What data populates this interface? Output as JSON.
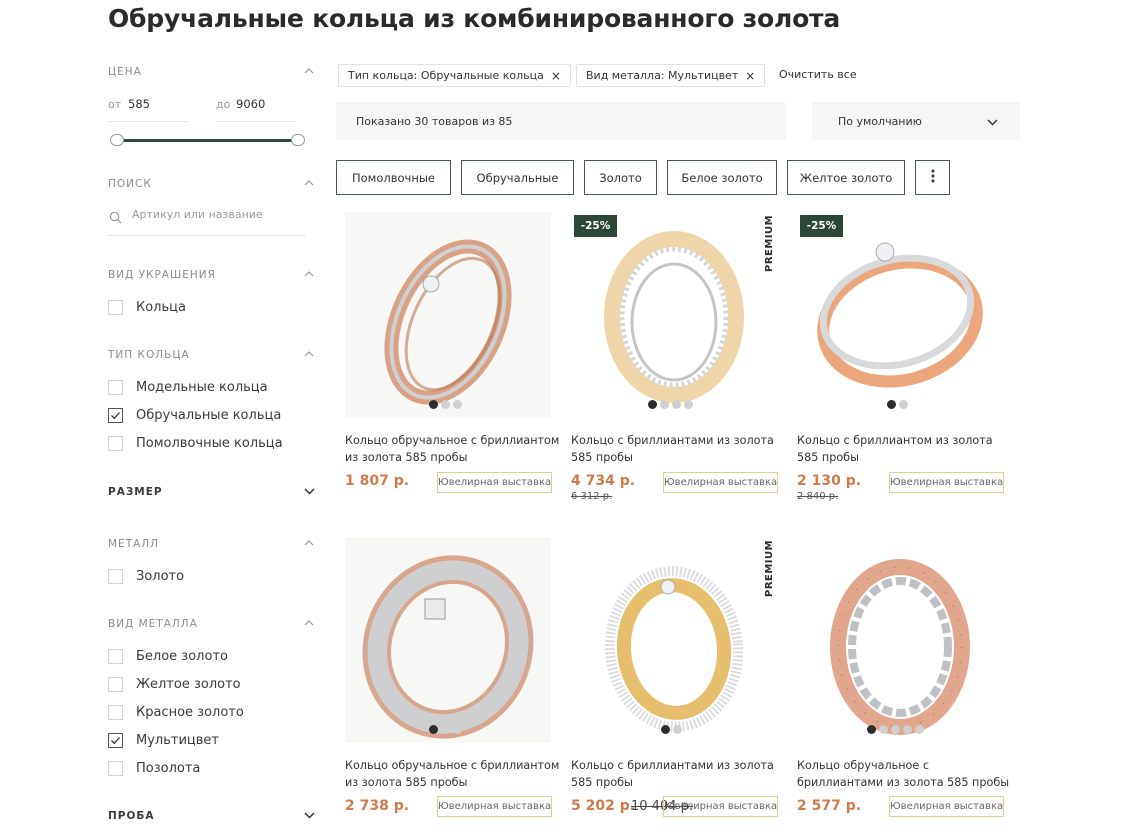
{
  "page": {
    "title": "Обручальные кольца из комбинированного золота"
  },
  "sidebar": {
    "price": {
      "title": "ЦЕНА",
      "from_label": "от",
      "from_value": "585",
      "to_label": "до",
      "to_value": "9060"
    },
    "search": {
      "title": "ПОИСК",
      "placeholder": "Артикул или название"
    },
    "jewelry_type": {
      "title": "ВИД УКРАШЕНИЯ",
      "items": [
        {
          "label": "Кольца",
          "checked": false
        }
      ]
    },
    "ring_type": {
      "title": "ТИП КОЛЬЦА",
      "items": [
        {
          "label": "Модельные кольца",
          "checked": false
        },
        {
          "label": "Обручальные кольца",
          "checked": true
        },
        {
          "label": "Помолвочные кольца",
          "checked": false
        }
      ]
    },
    "size": {
      "title": "РАЗМЕР"
    },
    "metal": {
      "title": "МЕТАЛЛ",
      "items": [
        {
          "label": "Золото",
          "checked": false
        }
      ]
    },
    "metal_kind": {
      "title": "ВИД МЕТАЛЛА",
      "items": [
        {
          "label": "Белое золото",
          "checked": false
        },
        {
          "label": "Желтое золото",
          "checked": false
        },
        {
          "label": "Красное золото",
          "checked": false
        },
        {
          "label": "Мультицвет",
          "checked": true
        },
        {
          "label": "Позолота",
          "checked": false
        }
      ]
    },
    "probe": {
      "title": "ПРОБА"
    }
  },
  "filters": {
    "active": [
      {
        "label": "Тип кольца: Обручальные кольца"
      },
      {
        "label": "Вид металла: Мультицвет"
      }
    ],
    "remove_glyph": "×",
    "clear_all": "Очистить все"
  },
  "results": {
    "shown_text": "Показано 30 товаров из 85",
    "sort_label": "По умолчанию"
  },
  "quick_filters": [
    "Помолвочные",
    "Обручальные",
    "Золото",
    "Белое золото",
    "Желтое золото"
  ],
  "colors": {
    "accent_green": "#2c4638",
    "price_orange": "#d17a4c",
    "store_border": "#e6cf8e"
  },
  "products": [
    {
      "name_line1": "Кольцо обручальное с бриллиантом",
      "name_line2": "из золота 585 пробы",
      "price": "1 807 р.",
      "old_price": "",
      "store": "Ювелирная выставка",
      "badge": "",
      "premium": "",
      "images": 3,
      "active_image": 0
    },
    {
      "name_line1": "Кольцо с бриллиантами из золота",
      "name_line2": "585 пробы",
      "price": "4 734 р.",
      "old_price": "6 312 р.",
      "store": "Ювелирная выставка",
      "badge": "-25%",
      "premium": "PREMIUM",
      "images": 4,
      "active_image": 0
    },
    {
      "name_line1": "Кольцо с бриллиантом из золота",
      "name_line2": "585 пробы",
      "price": "2 130 р.",
      "old_price": "2 840 р.",
      "store": "Ювелирная выставка",
      "badge": "-25%",
      "premium": "",
      "images": 2,
      "active_image": 0
    },
    {
      "name_line1": "Кольцо обручальное с бриллиантом",
      "name_line2": "из золота 585 пробы",
      "price": "2 738 р.",
      "old_price": "",
      "store": "Ювелирная выставка",
      "badge": "",
      "premium": "",
      "images": 3,
      "active_image": 0
    },
    {
      "name_line1": "Кольцо с бриллиантами из золота",
      "name_line2": "585 пробы",
      "price": "5 202 р.",
      "old_price": "10 404 р.",
      "store": "Ювелирная выставка",
      "badge": "",
      "premium": "PREMIUM",
      "images": 2,
      "active_image": 0
    },
    {
      "name_line1": "Кольцо обручальное с",
      "name_line2": "бриллиантами из золота 585 пробы",
      "price": "2 577 р.",
      "old_price": "",
      "store": "Ювелирная выставка",
      "badge": "",
      "premium": "",
      "images": 5,
      "active_image": 0
    }
  ]
}
